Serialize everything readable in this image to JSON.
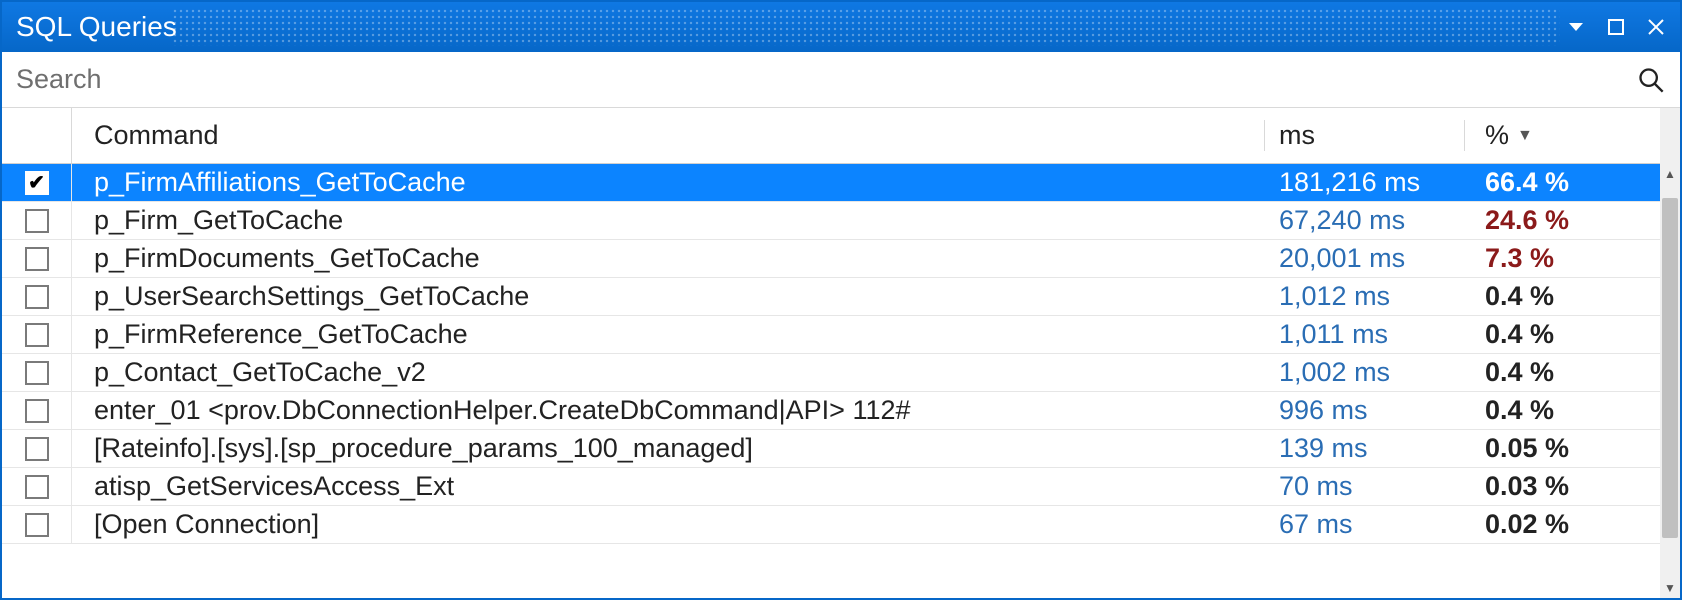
{
  "window": {
    "title": "SQL Queries"
  },
  "search": {
    "placeholder": "Search"
  },
  "columns": {
    "command": "Command",
    "ms": "ms",
    "pct": "%"
  },
  "rows": [
    {
      "checked": true,
      "selected": true,
      "command": "p_FirmAffiliations_GetToCache",
      "ms": "181,216 ms",
      "pct": "66.4 %",
      "hot": true
    },
    {
      "checked": false,
      "selected": false,
      "command": "p_Firm_GetToCache",
      "ms": "67,240 ms",
      "pct": "24.6 %",
      "hot": true
    },
    {
      "checked": false,
      "selected": false,
      "command": "p_FirmDocuments_GetToCache",
      "ms": "20,001 ms",
      "pct": "7.3 %",
      "hot": true
    },
    {
      "checked": false,
      "selected": false,
      "command": "p_UserSearchSettings_GetToCache",
      "ms": "1,012 ms",
      "pct": "0.4 %",
      "hot": false
    },
    {
      "checked": false,
      "selected": false,
      "command": "p_FirmReference_GetToCache",
      "ms": "1,011 ms",
      "pct": "0.4 %",
      "hot": false
    },
    {
      "checked": false,
      "selected": false,
      "command": "p_Contact_GetToCache_v2",
      "ms": "1,002 ms",
      "pct": "0.4 %",
      "hot": false
    },
    {
      "checked": false,
      "selected": false,
      "command": "enter_01 <prov.DbConnectionHelper.CreateDbCommand|API> 112#",
      "ms": "996 ms",
      "pct": "0.4 %",
      "hot": false
    },
    {
      "checked": false,
      "selected": false,
      "command": "[Rateinfo].[sys].[sp_procedure_params_100_managed]",
      "ms": "139 ms",
      "pct": "0.05 %",
      "hot": false
    },
    {
      "checked": false,
      "selected": false,
      "command": "atisp_GetServicesAccess_Ext",
      "ms": "70 ms",
      "pct": "0.03 %",
      "hot": false
    },
    {
      "checked": false,
      "selected": false,
      "command": "[Open Connection]",
      "ms": "67 ms",
      "pct": "0.02 %",
      "hot": false
    }
  ]
}
